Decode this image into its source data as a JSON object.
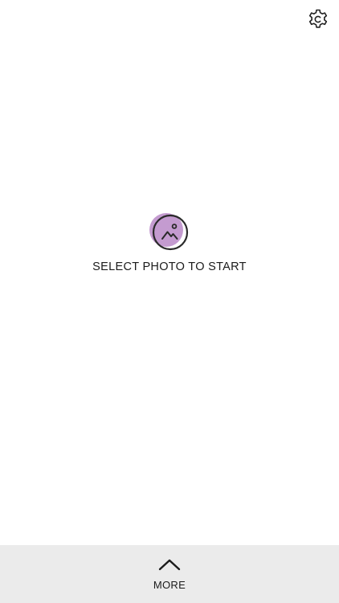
{
  "header": {
    "settings_icon": "gear-icon"
  },
  "main": {
    "photo_icon": "image-picker-icon",
    "prompt": "SELECT PHOTO TO START",
    "accent_color": "#c49bd0"
  },
  "bottom_bar": {
    "icon": "chevron-up-icon",
    "label": "MORE",
    "background": "#ebebeb"
  }
}
